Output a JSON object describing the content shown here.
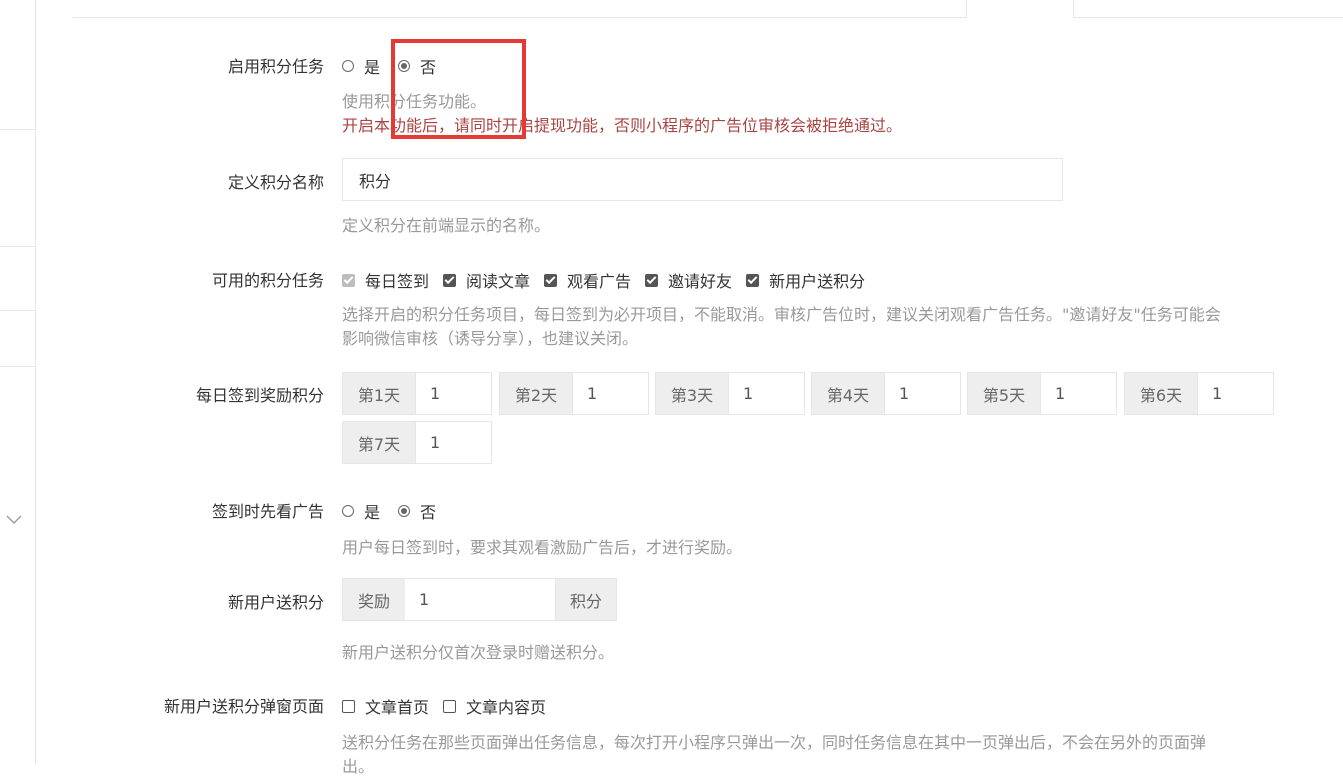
{
  "settings": {
    "enable_tasks": {
      "label": "启用积分任务",
      "options": [
        "是",
        "否"
      ],
      "selected": "否",
      "help": "使用积分任务功能。",
      "warning": "开启本功能后，请同时开启提现功能，否则小程序的广告位审核会被拒绝通过。"
    },
    "points_name": {
      "label": "定义积分名称",
      "value": "积分",
      "help": "定义积分在前端显示的名称。"
    },
    "available_tasks": {
      "label": "可用的积分任务",
      "items": [
        {
          "label": "每日签到",
          "checked": true,
          "disabled": true
        },
        {
          "label": "阅读文章",
          "checked": true,
          "disabled": false
        },
        {
          "label": "观看广告",
          "checked": true,
          "disabled": false
        },
        {
          "label": "邀请好友",
          "checked": true,
          "disabled": false
        },
        {
          "label": "新用户送积分",
          "checked": true,
          "disabled": false
        }
      ],
      "help_line1": "选择开启的积分任务项目，每日签到为必开项目，不能取消。审核广告位时，建议关闭观看广告任务。\"邀请好友\"任务可能会",
      "help_line2": "影响微信审核（诱导分享），也建议关闭。"
    },
    "daily_signin_points": {
      "label": "每日签到奖励积分",
      "days": [
        {
          "label": "第1天",
          "value": "1"
        },
        {
          "label": "第2天",
          "value": "1"
        },
        {
          "label": "第3天",
          "value": "1"
        },
        {
          "label": "第4天",
          "value": "1"
        },
        {
          "label": "第5天",
          "value": "1"
        },
        {
          "label": "第6天",
          "value": "1"
        },
        {
          "label": "第7天",
          "value": "1"
        }
      ]
    },
    "ad_before_signin": {
      "label": "签到时先看广告",
      "options": [
        "是",
        "否"
      ],
      "selected": "否",
      "help": "用户每日签到时，要求其观看激励广告后，才进行奖励。"
    },
    "new_user_points": {
      "label": "新用户送积分",
      "prefix": "奖励",
      "value": "1",
      "suffix": "积分",
      "help": "新用户送积分仅首次登录时赠送积分。"
    },
    "new_user_popup_pages": {
      "label": "新用户送积分弹窗页面",
      "items": [
        {
          "label": "文章首页",
          "checked": false
        },
        {
          "label": "文章内容页",
          "checked": false
        }
      ],
      "help_line1": "送积分任务在那些页面弹出任务信息，每次打开小程序只弹出一次，同时任务信息在其中一页弹出后，不会在另外的页面弹",
      "help_line2": "出。"
    }
  },
  "colors": {
    "warning": "#a94442",
    "help": "#999999",
    "highlight": "#e53935",
    "addon_bg": "#eeeeee"
  }
}
